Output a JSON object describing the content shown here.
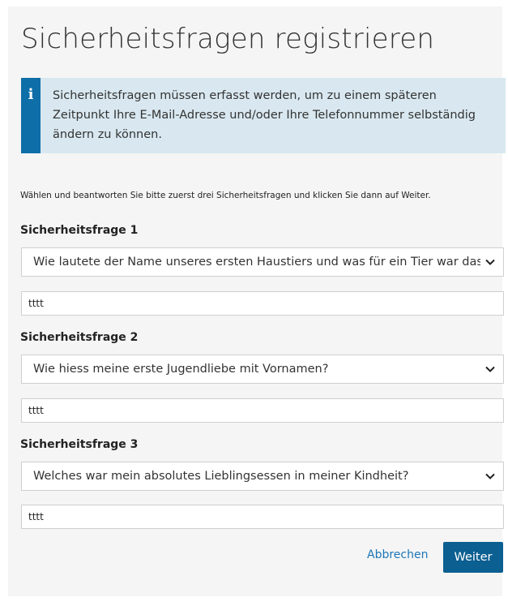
{
  "page": {
    "title": "Sicherheitsfragen registrieren"
  },
  "info": {
    "icon": "info-icon",
    "icon_glyph": "i",
    "text": "Sicherheitsfragen müssen erfasst werden, um zu einem späteren Zeitpunkt Ihre E-Mail-Adresse und/oder Ihre Telefonnummer selbständig ändern zu können."
  },
  "intro": "Wählen und beantworten Sie bitte zuerst drei Sicherheitsfragen und klicken Sie dann auf Weiter.",
  "questions": [
    {
      "label": "Sicherheitsfrage 1",
      "selected": "Wie lautete der Name unseres ersten Haustiers und was für ein Tier war das?",
      "answer": "tttt"
    },
    {
      "label": "Sicherheitsfrage 2",
      "selected": "Wie hiess meine erste Jugendliebe mit Vornamen?",
      "answer": "tttt"
    },
    {
      "label": "Sicherheitsfrage 3",
      "selected": "Welches war mein absolutes Lieblingsessen in meiner Kindheit?",
      "answer": "tttt"
    }
  ],
  "actions": {
    "cancel_label": "Abbrechen",
    "next_label": "Weiter"
  },
  "colors": {
    "accent": "#0e6ea8",
    "info_background": "#d9e8f0",
    "link": "#1d76b6",
    "primary_button": "#0b5f91"
  }
}
